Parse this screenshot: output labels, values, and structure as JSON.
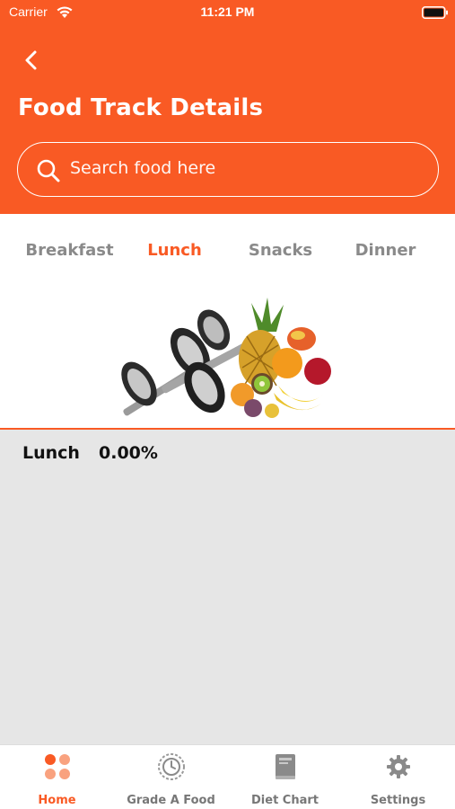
{
  "status_bar": {
    "carrier": "Carrier",
    "time": "11:21 PM"
  },
  "header": {
    "back_icon": "chevron-left-icon",
    "title": "Food Track Details",
    "search": {
      "placeholder": "Search food here",
      "icon": "search-icon"
    }
  },
  "tabs": [
    {
      "label": "Breakfast",
      "active": false
    },
    {
      "label": "Lunch",
      "active": true
    },
    {
      "label": "Snacks",
      "active": false
    },
    {
      "label": "Dinner",
      "active": false
    }
  ],
  "hero_image": "dumbbells-and-fruits-image",
  "summary": {
    "meal": "Lunch",
    "percent": "0.00%"
  },
  "bottom_tabs": [
    {
      "label": "Home",
      "icon": "home-dots-icon",
      "active": true
    },
    {
      "label": "Grade A Food",
      "icon": "clock-icon",
      "active": false
    },
    {
      "label": "Diet Chart",
      "icon": "book-icon",
      "active": false
    },
    {
      "label": "Settings",
      "icon": "gear-icon",
      "active": false
    }
  ],
  "colors": {
    "accent": "#F95A24",
    "content_bg": "#E6E6E6",
    "inactive_text": "#8A8A8A"
  }
}
